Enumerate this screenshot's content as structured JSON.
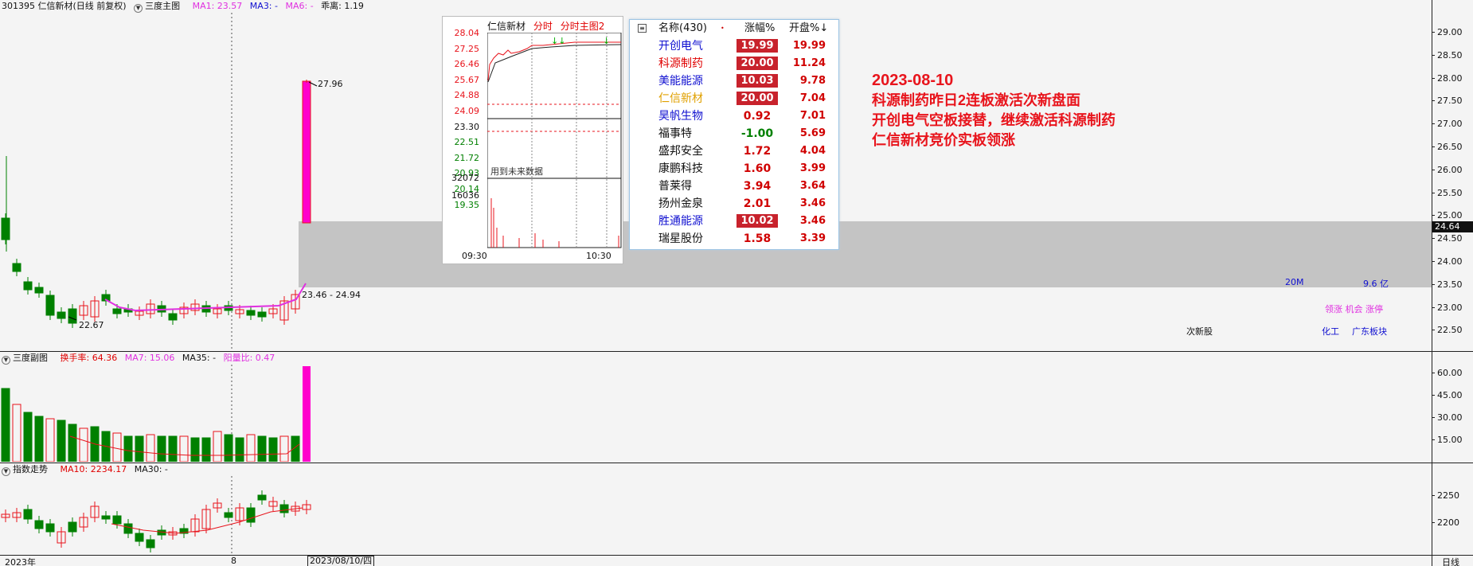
{
  "main_pane": {
    "code_name": "301395 仁信新材(日线 前复权)",
    "indicator_name": "三度主图",
    "ma1": "MA1: 23.57",
    "ma3": "MA3: -",
    "ma6": "MA6: -",
    "extra": "乖离: 1.19",
    "high_label": "27.96",
    "low_label": "22.67",
    "range_label": "23.46 - 24.94",
    "current_price_tag": "24.64",
    "yticks": [
      "29.00",
      "28.50",
      "28.00",
      "27.50",
      "27.00",
      "26.50",
      "26.00",
      "25.50",
      "25.00",
      "24.50",
      "24.00",
      "23.50",
      "23.00",
      "22.50"
    ],
    "vol_20m": "20M",
    "vol_amount": "9.6 亿",
    "tags_line1": "领涨 机会 涨停",
    "category": "次新股",
    "sector1": "化工",
    "sector2": "广东板块"
  },
  "annotation": {
    "date": "2023-08-10",
    "line1": "科源制药昨日2连板激活次新盘面",
    "line2": "开创电气空板接替，继续激活科源制药",
    "line3": "仁信新材竞价实板领涨"
  },
  "mini_chart": {
    "stock": "仁信新材",
    "tab1": "分时",
    "tab2": "分时主图2",
    "prices": [
      "28.04",
      "27.25",
      "26.46",
      "25.67",
      "24.88",
      "24.09",
      "23.30",
      "22.51",
      "21.72",
      "20.93",
      "20.14",
      "19.35"
    ],
    "notice": "用到未来数据",
    "vol_top": "32072",
    "vol_mid": "16036",
    "time_start": "09:30",
    "time_end": "10:30"
  },
  "watchlist": {
    "header_name": "名称(430)",
    "header_dot": "•",
    "header_chg": "涨幅%",
    "header_open": "开盘%↓",
    "rows": [
      {
        "name": "开创电气",
        "chg": "19.99",
        "open": "19.99"
      },
      {
        "name": "科源制药",
        "chg": "20.00",
        "open": "11.24"
      },
      {
        "name": "美能能源",
        "chg": "10.03",
        "open": "9.78"
      },
      {
        "name": "仁信新材",
        "chg": "20.00",
        "open": "7.04"
      },
      {
        "name": "昊帆生物",
        "chg": "0.92",
        "open": "7.01"
      },
      {
        "name": "福事特",
        "chg": "-1.00",
        "open": "5.69"
      },
      {
        "name": "盛邦安全",
        "chg": "1.72",
        "open": "4.04"
      },
      {
        "name": "康鹏科技",
        "chg": "1.60",
        "open": "3.99"
      },
      {
        "name": "普莱得",
        "chg": "3.94",
        "open": "3.64"
      },
      {
        "name": "扬州金泉",
        "chg": "2.01",
        "open": "3.46"
      },
      {
        "name": "胜通能源",
        "chg": "10.02",
        "open": "3.46"
      },
      {
        "name": "瑞星股份",
        "chg": "1.58",
        "open": "3.39"
      }
    ]
  },
  "sub_pane": {
    "name": "三度副图",
    "turnover": "换手率: 64.36",
    "ma7": "MA7: 15.06",
    "ma35": "MA35: -",
    "ratio": "阳量比: 0.47",
    "yticks": [
      "60.00",
      "45.00",
      "30.00",
      "15.00"
    ]
  },
  "index_pane": {
    "name": "指数走势",
    "ma10": "MA10: 2234.17",
    "ma30": "MA30: -",
    "yticks": [
      "2250",
      "2200"
    ]
  },
  "bottom": {
    "year": "2023年",
    "month": "8",
    "cursor_date": "2023/08/10/四",
    "period": "日线"
  },
  "colors": {
    "up": "#e8141c",
    "down": "#008000",
    "limit": "#ff00cc",
    "ann": "#e8141c"
  }
}
